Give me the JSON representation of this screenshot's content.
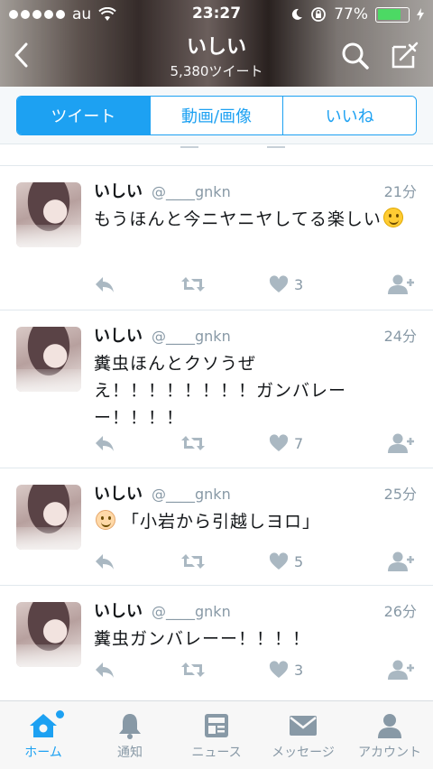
{
  "status_bar": {
    "carrier": "au",
    "time": "23:27",
    "battery": "77%",
    "battery_level": 0.77
  },
  "header": {
    "title": "いしい",
    "tweet_count": "5,380ツイート"
  },
  "segments": [
    {
      "label": "ツイート",
      "active": true
    },
    {
      "label": "動画/画像",
      "active": false
    },
    {
      "label": "いいね",
      "active": false
    }
  ],
  "tweets": [
    {
      "name": "いしい",
      "handle": "@____gnkn",
      "time": "21分",
      "text": "もうほんと今ニヤニヤしてる楽しい",
      "emoji": "smiling-face",
      "likes": "3"
    },
    {
      "name": "いしい",
      "handle": "@____gnkn",
      "time": "24分",
      "text": "糞虫ほんとクソうぜえ！！！！！！！！ガンバレーー！！！！",
      "emoji": "",
      "likes": "7"
    },
    {
      "name": "いしい",
      "handle": "@____gnkn",
      "time": "25分",
      "text": "「小岩から引越しヨロ」",
      "emoji": "baby-face",
      "likes": "5"
    },
    {
      "name": "いしい",
      "handle": "@____gnkn",
      "time": "26分",
      "text": "糞虫ガンバレーー！！！！",
      "emoji": "",
      "likes": "3"
    }
  ],
  "tabbar": {
    "home": "ホーム",
    "notifications": "通知",
    "news": "ニュース",
    "messages": "メッセージ",
    "account": "アカウント"
  },
  "colors": {
    "accent": "#1da1f2",
    "muted": "#8899a6"
  }
}
